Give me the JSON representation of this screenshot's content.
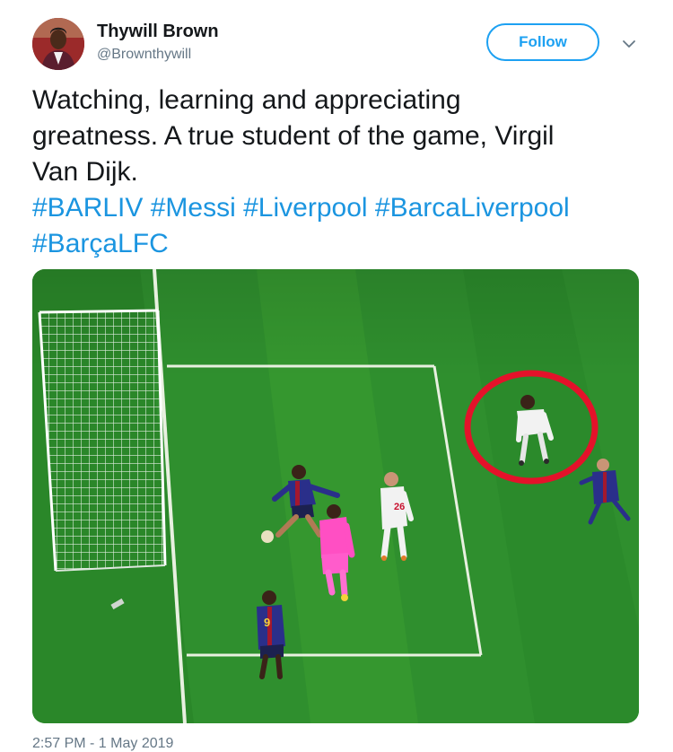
{
  "author": {
    "name": "Thywill Brown",
    "handle": "@Brownthywill"
  },
  "follow_label": "Follow",
  "text_lines": [
    "Watching, learning and appreciating",
    "greatness. A true student of the game, Virgil",
    "Van Dijk."
  ],
  "hashtags": [
    "#BARLIV",
    "#Messi",
    "#Liverpool",
    "#BarcaLiverpool",
    "#BarçaLFC"
  ],
  "media": {
    "jersey_number_front": "9",
    "jersey_number_back": "26"
  },
  "timestamp": "2:57 PM - 1 May 2019",
  "colors": {
    "link": "#1b95e0",
    "follow": "#1da1f2",
    "pitch": "#2f8f2e",
    "circle": "#e4122a"
  }
}
